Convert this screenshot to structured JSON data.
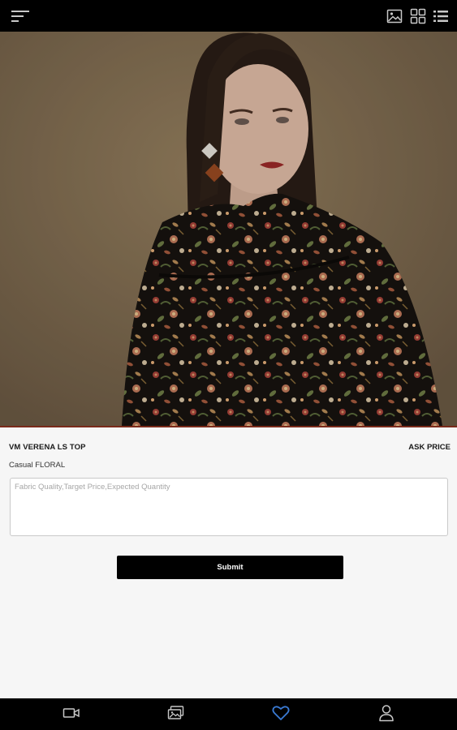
{
  "app": {
    "colors": {
      "bar": "#000000",
      "background": "#f6f6f6",
      "active_tab": "#3a7bd5",
      "icon": "#c8c8c8"
    }
  },
  "topbar": {
    "icons": [
      "menu-icon",
      "gallery-icon",
      "grid-icon",
      "list-icon"
    ]
  },
  "hero": {
    "image": "product-photo"
  },
  "product": {
    "title": "VM VERENA LS TOP",
    "price_label": "ASK PRICE",
    "subtitle": "Casual FLORAL"
  },
  "inquiry": {
    "value": "",
    "placeholder": "Fabric Quality,Target Price,Expected Quantity"
  },
  "submit_label": "Submit",
  "bottombar": {
    "tabs": [
      {
        "icon": "video-icon",
        "active": false
      },
      {
        "icon": "photos-icon",
        "active": false
      },
      {
        "icon": "heart-icon",
        "active": true
      },
      {
        "icon": "user-icon",
        "active": false
      }
    ]
  }
}
